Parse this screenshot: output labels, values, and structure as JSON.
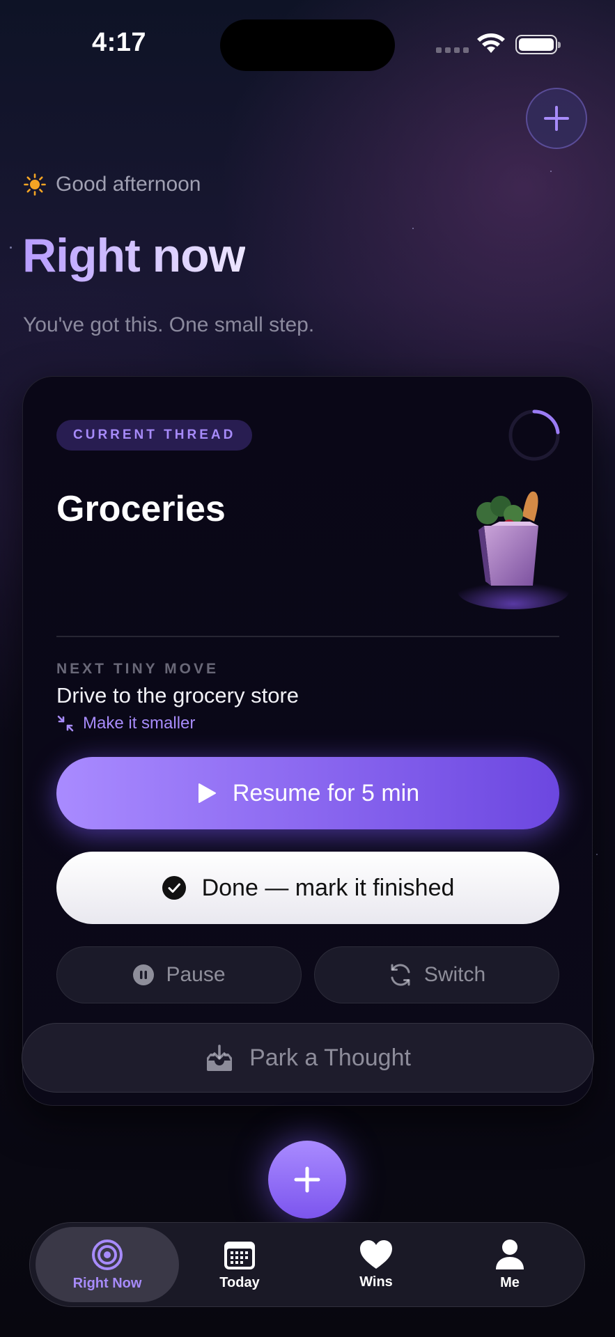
{
  "status_bar": {
    "time": "4:17"
  },
  "greeting": {
    "icon": "sun-icon",
    "text": "Good afternoon"
  },
  "header": {
    "title": "Right now",
    "subtitle": "You've got this. One small step."
  },
  "card": {
    "pill": "CURRENT THREAD",
    "thread_title": "Groceries",
    "image": "grocery-bag-illustration",
    "next_move_label": "NEXT TINY MOVE",
    "next_move_task": "Drive to the grocery store",
    "make_smaller": "Make it smaller",
    "resume_label": "Resume for 5 min",
    "done_label": "Done — mark it finished",
    "pause_label": "Pause",
    "switch_label": "Switch",
    "park_label": "Park a Thought"
  },
  "tabs": [
    {
      "label": "Right Now",
      "icon": "target-icon",
      "active": true
    },
    {
      "label": "Today",
      "icon": "calendar-icon",
      "active": false
    },
    {
      "label": "Wins",
      "icon": "heart-icon",
      "active": false
    },
    {
      "label": "Me",
      "icon": "person-icon",
      "active": false
    }
  ],
  "colors": {
    "accent": "#A78BFA",
    "accent_dark": "#6C47E0",
    "background": "#08070F",
    "card": "#0A0717"
  }
}
